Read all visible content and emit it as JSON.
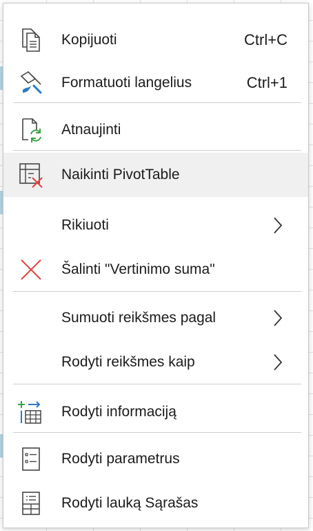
{
  "menu": {
    "items": [
      {
        "label": "Kopijuoti",
        "shortcut": "Ctrl+C",
        "icon": "copy-icon"
      },
      {
        "label": "Formatuoti langelius",
        "shortcut": "Ctrl+1",
        "icon": "format-cells-icon"
      },
      {
        "label": "Atnaujinti",
        "icon": "refresh-icon"
      },
      {
        "label": "Naikinti PivotTable",
        "icon": "delete-pivottable-icon"
      },
      {
        "label": "Rikiuoti",
        "icon": "chevron-right-icon"
      },
      {
        "label": "Šalinti \"Vertinimo suma\"",
        "icon": "remove-field-icon"
      },
      {
        "label": "Sumuoti reikšmes pagal",
        "icon": "chevron-right-icon"
      },
      {
        "label": "Rodyti reikšmes kaip",
        "icon": "chevron-right-icon"
      },
      {
        "label": "Rodyti informaciją",
        "icon": "show-details-icon"
      },
      {
        "label": "Rodyti parametrus",
        "icon": "options-icon"
      },
      {
        "label": "Rodyti lauką Sąrašas",
        "icon": "field-list-icon"
      }
    ]
  },
  "colors": {
    "accent_blue": "#2b79c2",
    "accent_green": "#3aa447",
    "delete_red": "#e04040",
    "hover_bg": "#f0f0f0"
  }
}
